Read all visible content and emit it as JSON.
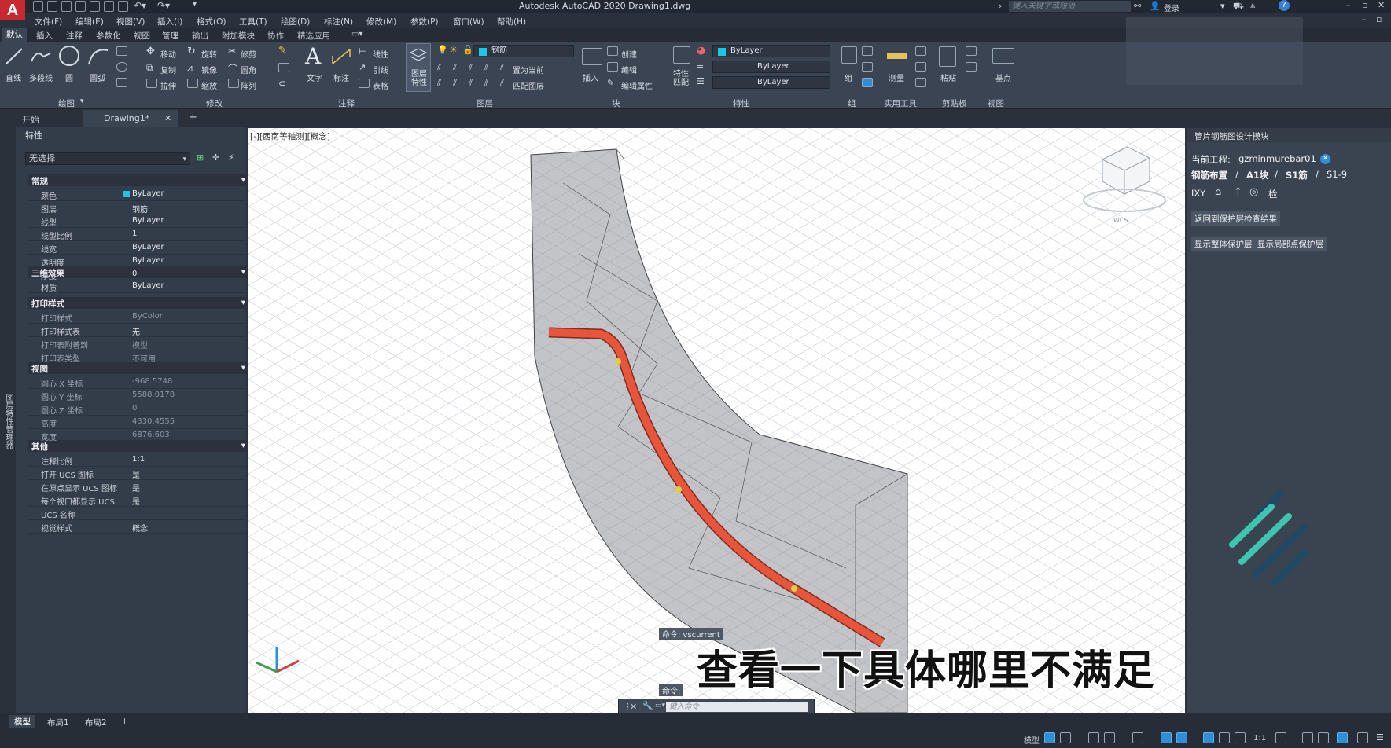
{
  "window": {
    "title": "Autodesk AutoCAD 2020    Drawing1.dwg",
    "search_placeholder": "键入关键字或短语",
    "login": "登录"
  },
  "menu": [
    "文件(F)",
    "编辑(E)",
    "视图(V)",
    "插入(I)",
    "格式(O)",
    "工具(T)",
    "绘图(D)",
    "标注(N)",
    "修改(M)",
    "参数(P)",
    "窗口(W)",
    "帮助(H)"
  ],
  "ribbon_tabs": [
    "默认",
    "插入",
    "注释",
    "参数化",
    "视图",
    "管理",
    "输出",
    "附加模块",
    "协作",
    "精选应用"
  ],
  "ribbon": {
    "draw": {
      "line": "直线",
      "polyline": "多段线",
      "circle": "圆",
      "arc": "圆弧",
      "label": "绘图"
    },
    "modify": {
      "move": "移动",
      "rotate": "旋转",
      "trim": "修剪",
      "copy": "复制",
      "mirror": "镜像",
      "fillet": "圆角",
      "stretch": "拉伸",
      "scale": "缩放",
      "array": "阵列",
      "label": "修改"
    },
    "annotation": {
      "text": "文字",
      "dimension": "标注",
      "linear": "线性",
      "leader": "引线",
      "table": "表格",
      "label": "注释"
    },
    "layers": {
      "layer_props": "图层\n特性",
      "current_layer": "钢筋",
      "set_current": "置为当前",
      "match_layer": "匹配图层",
      "label": "图层"
    },
    "block": {
      "insert": "插入",
      "create": "创建",
      "edit": "编辑",
      "edit_attr": "编辑属性",
      "label": "块"
    },
    "properties": {
      "match": "特性\n匹配",
      "color": "ByLayer",
      "linetype": "ByLayer",
      "lineweight": "ByLayer",
      "label": "特性"
    },
    "groups": {
      "group": "组",
      "label": "组"
    },
    "utilities": {
      "measure": "测量",
      "label": "实用工具"
    },
    "clipboard": {
      "paste": "粘贴",
      "label": "剪贴板"
    },
    "view": {
      "base": "基点",
      "label": "视图"
    }
  },
  "doc_tabs": {
    "start": "开始",
    "drawing": "Drawing1*",
    "close": "✕",
    "add": "+"
  },
  "properties_palette": {
    "title": "特性",
    "selection": "无选择",
    "sections": {
      "general": "常规",
      "effects3d": "三维效果",
      "plotstyle": "打印样式",
      "view": "视图",
      "misc": "其他"
    },
    "general": [
      {
        "k": "颜色",
        "v": "ByLayer"
      },
      {
        "k": "图层",
        "v": "钢筋"
      },
      {
        "k": "线型",
        "v": "ByLayer"
      },
      {
        "k": "线型比例",
        "v": "1"
      },
      {
        "k": "线宽",
        "v": "ByLayer"
      },
      {
        "k": "透明度",
        "v": "ByLayer"
      },
      {
        "k": "厚度",
        "v": "0"
      }
    ],
    "effects3d": [
      {
        "k": "材质",
        "v": "ByLayer"
      }
    ],
    "plotstyle": [
      {
        "k": "打印样式",
        "v": "ByColor"
      },
      {
        "k": "打印样式表",
        "v": "无"
      },
      {
        "k": "打印表附着到",
        "v": "模型"
      },
      {
        "k": "打印表类型",
        "v": "不可用"
      }
    ],
    "view": [
      {
        "k": "圆心 X 坐标",
        "v": "-968.5748"
      },
      {
        "k": "圆心 Y 坐标",
        "v": "5588.0178"
      },
      {
        "k": "圆心 Z 坐标",
        "v": "0"
      },
      {
        "k": "高度",
        "v": "4330.4555"
      },
      {
        "k": "宽度",
        "v": "6876.603"
      }
    ],
    "misc": [
      {
        "k": "注释比例",
        "v": "1:1"
      },
      {
        "k": "打开 UCS 图标",
        "v": "是"
      },
      {
        "k": "在原点显示 UCS 图标",
        "v": "是"
      },
      {
        "k": "每个视口都显示 UCS",
        "v": "是"
      },
      {
        "k": "UCS 名称",
        "v": ""
      },
      {
        "k": "视觉样式",
        "v": "概念"
      }
    ]
  },
  "left_strip_label": "图层特性管理器",
  "viewport": {
    "label": "[-][西南等轴测][概念]",
    "subtitle": "查看一下具体哪里不满足",
    "cmd_history_1": "命令: vscurrent",
    "cmd_history_2": "命令:",
    "cmd_placeholder": "键入命令",
    "wcs": "WCS"
  },
  "right_panel": {
    "title": "管片钢筋图设计模块",
    "project_label": "当前工程:",
    "project_name": "gzminmurebar01",
    "breadcrumb": [
      "钢筋布置",
      "A1块",
      "S1筋",
      "S1-9"
    ],
    "separator": "/",
    "tool_labels": {
      "ixy": "IXY",
      "check": "检"
    },
    "btn_return": "返回到保护层检查结果",
    "btn_show_all": "显示整体保护层",
    "btn_show_local": "显示局部点保护层"
  },
  "status": {
    "tabs": [
      "模型",
      "布局1",
      "布局2"
    ],
    "add": "+",
    "model": "模型",
    "scale": "1:1"
  },
  "colors": {
    "accent": "#2f8fd6",
    "rebar": "#e8553b",
    "cyan": "#1ec7e6",
    "logo_teal": "#3fc4b0"
  }
}
